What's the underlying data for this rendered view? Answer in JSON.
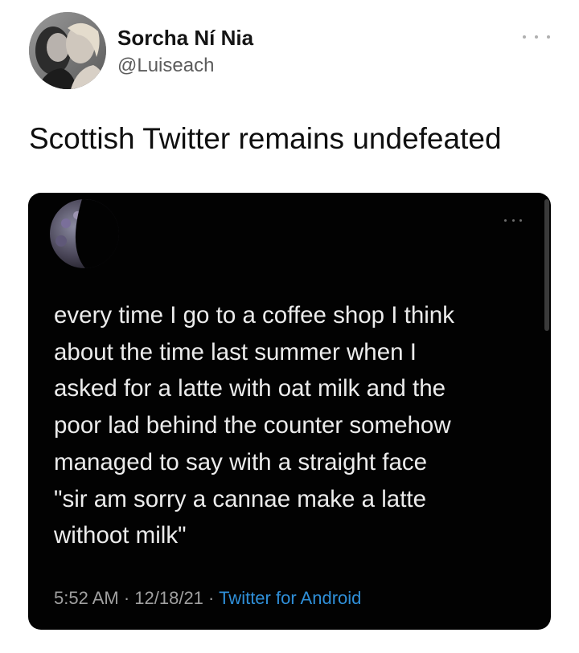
{
  "tweet": {
    "author_name": "Sorcha Ní Nia",
    "author_handle": "@Luiseach",
    "text": "Scottish Twitter remains undefeated",
    "more_icon": "more-horizontal-icon"
  },
  "quoted_screenshot": {
    "text": "every time I go to a coffee shop I think\nabout the time last summer when I\nasked for a latte with oat milk and the\npoor lad behind the counter somehow\nmanaged to say with a straight face\n\"sir am sorry a cannae make a latte\nwithoot milk\"",
    "time": "5:52 AM",
    "separator": " · ",
    "date": "12/18/21",
    "source": "Twitter for Android",
    "background_color": "#020202",
    "link_color": "#2f8fd8"
  }
}
